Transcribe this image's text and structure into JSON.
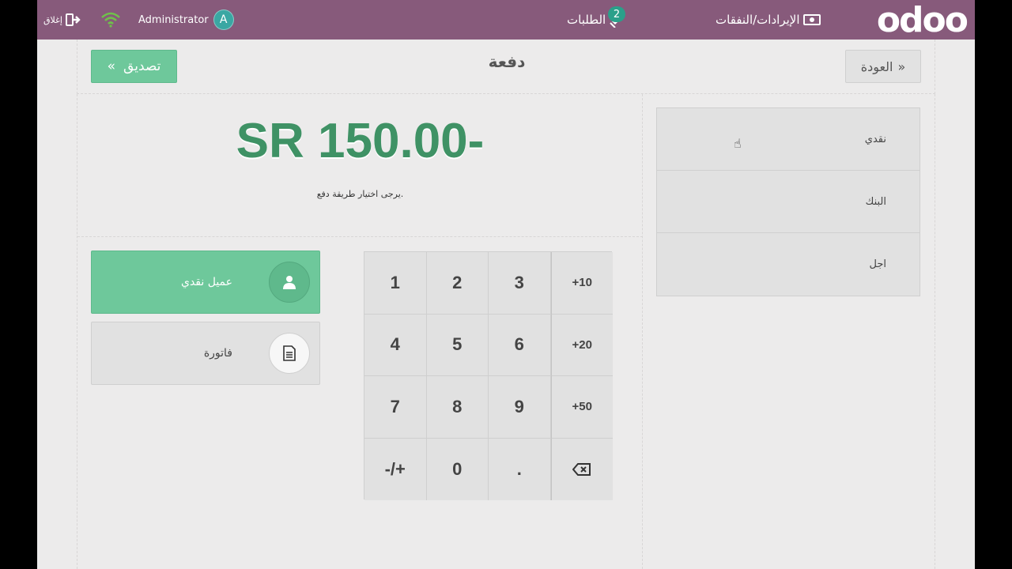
{
  "topbar": {
    "close_label": "إغلاق",
    "user_name": "Administrator",
    "user_initial": "A",
    "orders_label": "الطلبات",
    "orders_count": "2",
    "cash_in_out_label": "الإيرادات/النفقات",
    "logo_text": "odoo",
    "bar_color": "#875a7b"
  },
  "header": {
    "validate_label": "تصديق",
    "title": "دفعة",
    "back_label": "العودة"
  },
  "payment": {
    "amount": "SR 150.00-",
    "hint": "يرجى اختيار طريقة دفع.",
    "amount_color": "#3f9265"
  },
  "payment_methods": [
    {
      "label": "نقدي"
    },
    {
      "label": "البنك"
    },
    {
      "label": "اجل"
    }
  ],
  "customer_button": {
    "label": "عميل نقدي",
    "icon": "user-icon"
  },
  "invoice_button": {
    "label": "فاتورة",
    "icon": "document-icon"
  },
  "numpad": {
    "keys": [
      "1",
      "2",
      "3",
      "+10",
      "4",
      "5",
      "6",
      "+20",
      "7",
      "8",
      "9",
      "+50",
      "-/+",
      "0",
      ".",
      "backspace"
    ]
  }
}
